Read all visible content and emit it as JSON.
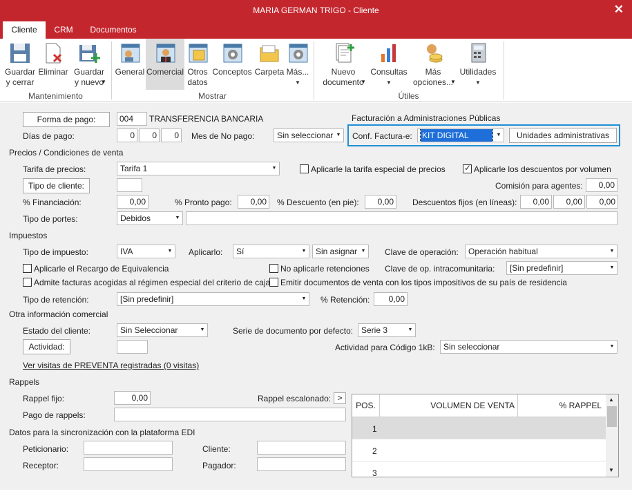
{
  "window": {
    "title": "MARIA GERMAN TRIGO - Cliente",
    "close": "✕"
  },
  "tabs": [
    "Cliente",
    "CRM",
    "Documentos"
  ],
  "ribbon": {
    "save_close": "Guardar\ny cerrar",
    "delete": "Eliminar",
    "save_new": "Guardar\ny nuevo",
    "general": "General",
    "commercial": "Comercial",
    "other_data": "Otros\ndatos",
    "concepts": "Conceptos",
    "folder": "Carpeta",
    "more": "Más...",
    "new_doc": "Nuevo\ndocumento",
    "queries": "Consultas",
    "more_options": "Más\nopciones...",
    "utilities": "Utilidades",
    "groups": [
      "Mantenimiento",
      "Mostrar",
      "Útiles"
    ]
  },
  "payment": {
    "method_btn": "Forma de pago:",
    "code": "004",
    "name": "TRANSFERENCIA BANCARIA",
    "days_label": "Días de pago:",
    "days": [
      "0",
      "0",
      "0"
    ],
    "no_pay_month_label": "Mes de No pago:",
    "no_pay_month": "Sin seleccionar"
  },
  "einvoice": {
    "title": "Facturación a Administraciones Públicas",
    "conf_label": "Conf. Factura-e:",
    "conf_value": "KIT DIGITAL",
    "units_btn": "Unidades administrativas"
  },
  "prices": {
    "section": "Precios / Condiciones de venta",
    "rate_label": "Tarifa de precios:",
    "rate": "Tarifa 1",
    "special_rate": "Aplicarle la tarifa especial de precios",
    "volume_discount": "Aplicarle los descuentos por volumen",
    "client_type_btn": "Tipo de cliente:",
    "client_type": "",
    "agent_commission_label": "Comisión para agentes:",
    "agent_commission": "0,00",
    "financing_label": "% Financiación:",
    "financing": "0,00",
    "prompt_pay_label": "% Pronto pago:",
    "prompt_pay": "0,00",
    "discount_label": "% Descuento (en pie):",
    "discount": "0,00",
    "fixed_discounts_label": "Descuentos fijos (en líneas):",
    "fixed_discounts": [
      "0,00",
      "0,00",
      "0,00"
    ],
    "shipping_label": "Tipo de portes:",
    "shipping": "Debidos",
    "shipping_text": ""
  },
  "taxes": {
    "section": "Impuestos",
    "tax_type_label": "Tipo de impuesto:",
    "tax_type": "IVA",
    "apply_label": "Aplicarlo:",
    "apply": "Sí",
    "assign": "Sin asignar",
    "op_key_label": "Clave de operación:",
    "op_key": "Operación habitual",
    "equivalence": "Aplicarle el Recargo de Equivalencia",
    "no_retentions": "No aplicarle retenciones",
    "intra_key_label": "Clave de op. intracomunitaria:",
    "intra_key": "[Sin predefinir]",
    "cash_criterion": "Admite facturas acogidas al régimen especial del criterio de caja",
    "issue_docs": "Emitir documentos de venta con los tipos impositivos de su país de residencia",
    "retention_type_label": "Tipo de retención:",
    "retention_type": "[Sin predefinir]",
    "retention_pct_label": "% Retención:",
    "retention_pct": "0,00"
  },
  "other": {
    "section": "Otra información comercial",
    "status_label": "Estado del cliente:",
    "status": "Sin Seleccionar",
    "series_label": "Serie de documento por defecto:",
    "series": "Serie 3",
    "activity_btn": "Actividad:",
    "activity": "",
    "activity_1kb_label": "Actividad para Código 1kB:",
    "activity_1kb": "Sin seleccionar",
    "presale_link": "Ver visitas de PREVENTA registradas (0 visitas)"
  },
  "rappels": {
    "section": "Rappels",
    "fixed_label": "Rappel fijo:",
    "fixed": "0,00",
    "scaled_label": "Rappel escalonado:",
    "scaled_btn": ">",
    "payment_label": "Pago de rappels:",
    "payment": "",
    "grid_headers": [
      "POS.",
      "VOLUMEN DE VENTA",
      "% RAPPEL"
    ],
    "grid_rows": [
      "1",
      "2",
      "3"
    ]
  },
  "edi": {
    "section": "Datos para la sincronización con la plataforma EDI",
    "requester_label": "Peticionario:",
    "client_label": "Cliente:",
    "receiver_label": "Receptor:",
    "payer_label": "Pagador:",
    "requester": "",
    "client": "",
    "receiver": "",
    "payer": ""
  }
}
